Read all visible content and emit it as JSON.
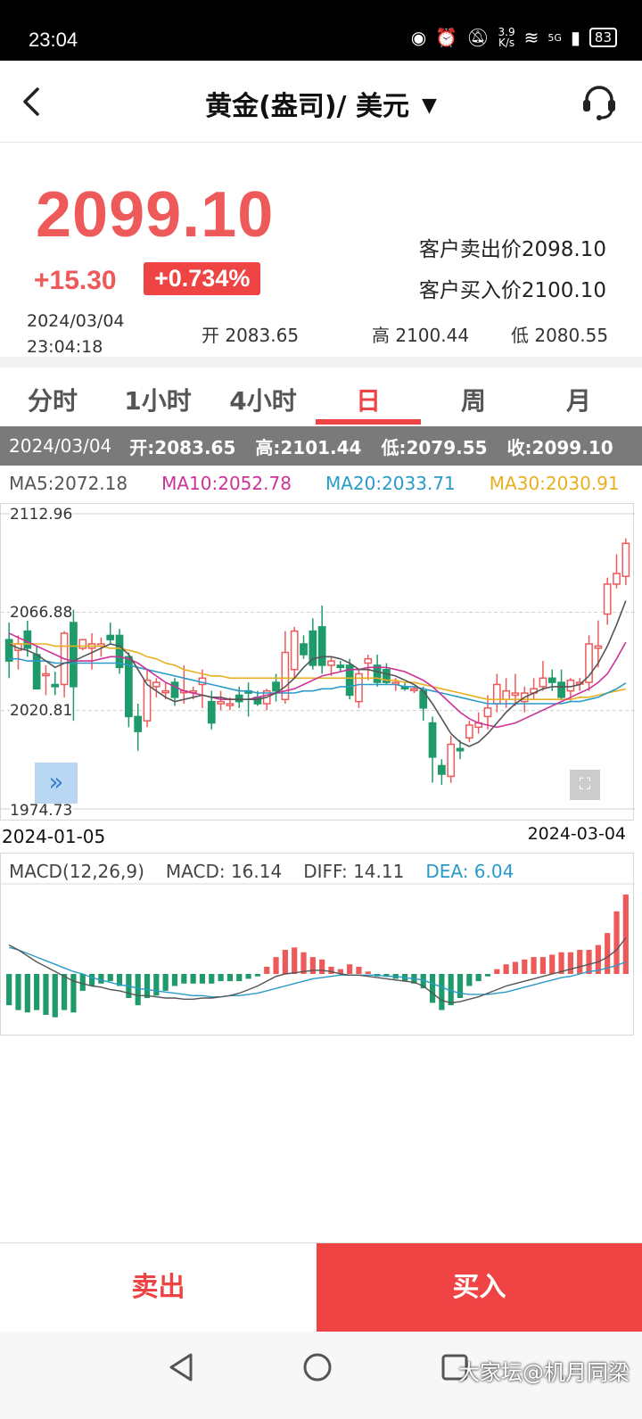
{
  "status": {
    "time": "23:04",
    "net_speed": "3.9",
    "net_unit": "K/s",
    "network": "5G",
    "battery": "83"
  },
  "header": {
    "title": "黄金(盎司)/ 美元",
    "caret": "▼"
  },
  "quote": {
    "price": "2099.10",
    "change": "+15.30",
    "change_pct": "+0.734%",
    "sell_price": "客户卖出价2098.10",
    "buy_price": "客户买入价2100.10",
    "date": "2024/03/04",
    "time": "23:04:18",
    "open": "开 2083.65",
    "high": "高 2100.44",
    "low": "低 2080.55"
  },
  "tabs": [
    {
      "label": "分时",
      "active": false
    },
    {
      "label": "1小时",
      "active": false
    },
    {
      "label": "4小时",
      "active": false
    },
    {
      "label": "日",
      "active": true
    },
    {
      "label": "周",
      "active": false
    },
    {
      "label": "月",
      "active": false
    }
  ],
  "info": {
    "date": "2024/03/04",
    "open": "开:2083.65",
    "high": "高:2101.44",
    "low": "低:2079.55",
    "close": "收:2099.10"
  },
  "ma": {
    "ma5": "MA5:2072.18",
    "ma10": "MA10:2052.78",
    "ma20": "MA20:2033.71",
    "ma30": "MA30:2030.91"
  },
  "colors": {
    "up": "#ee5a5a",
    "down": "#1f9a6a",
    "ma5": "#555555",
    "ma10": "#cc3399",
    "ma20": "#2a9ac8",
    "ma30": "#e8b020"
  },
  "chart": {
    "y_labels": [
      "2112.96",
      "2066.88",
      "2020.81",
      "1974.73"
    ],
    "date_start": "2024-01-05",
    "date_end": "2024-03-04",
    "expand_icon": "»",
    "fullscreen_icon": "⛶"
  },
  "macd": {
    "title": "MACD(12,26,9)",
    "macd": "MACD: 16.14",
    "diff": "DIFF: 14.11",
    "dea": "DEA: 6.04"
  },
  "actions": {
    "sell": "卖出",
    "buy": "买入"
  },
  "watermark": "大家坛@机月同梁",
  "chart_data": {
    "type": "candlestick",
    "ylim": [
      1974.73,
      2112.96
    ],
    "y_ticks": [
      2112.96,
      2066.88,
      2020.81,
      1974.73
    ],
    "x_range": [
      "2024-01-05",
      "2024-03-04"
    ],
    "candles": [
      {
        "o": 2054,
        "h": 2062,
        "l": 2036,
        "c": 2044
      },
      {
        "o": 2049,
        "h": 2056,
        "l": 2040,
        "c": 2052
      },
      {
        "o": 2058,
        "h": 2063,
        "l": 2046,
        "c": 2050
      },
      {
        "o": 2047,
        "h": 2051,
        "l": 2032,
        "c": 2031
      },
      {
        "o": 2038,
        "h": 2042,
        "l": 2028,
        "c": 2038
      },
      {
        "o": 2033,
        "h": 2039,
        "l": 2028,
        "c": 2032
      },
      {
        "o": 2033,
        "h": 2058,
        "l": 2027,
        "c": 2057
      },
      {
        "o": 2062,
        "h": 2068,
        "l": 2016,
        "c": 2032
      },
      {
        "o": 2050,
        "h": 2054,
        "l": 2049,
        "c": 2054
      },
      {
        "o": 2050,
        "h": 2057,
        "l": 2040,
        "c": 2052
      },
      {
        "o": 2051,
        "h": 2055,
        "l": 2046,
        "c": 2052
      },
      {
        "o": 2056,
        "h": 2062,
        "l": 2052,
        "c": 2054
      },
      {
        "o": 2056,
        "h": 2059,
        "l": 2038,
        "c": 2041
      },
      {
        "o": 2046,
        "h": 2048,
        "l": 2013,
        "c": 2018
      },
      {
        "o": 2018,
        "h": 2024,
        "l": 2002,
        "c": 2011
      },
      {
        "o": 2016,
        "h": 2040,
        "l": 2013,
        "c": 2035
      },
      {
        "o": 2032,
        "h": 2036,
        "l": 2027,
        "c": 2034
      },
      {
        "o": 2030,
        "h": 2034,
        "l": 2026,
        "c": 2030
      },
      {
        "o": 2034,
        "h": 2036,
        "l": 2023,
        "c": 2027
      },
      {
        "o": 2030,
        "h": 2042,
        "l": 2024,
        "c": 2030
      },
      {
        "o": 2030,
        "h": 2032,
        "l": 2026,
        "c": 2030
      },
      {
        "o": 2033,
        "h": 2040,
        "l": 2022,
        "c": 2036
      },
      {
        "o": 2025,
        "h": 2030,
        "l": 2012,
        "c": 2015
      },
      {
        "o": 2024,
        "h": 2030,
        "l": 2021,
        "c": 2025
      },
      {
        "o": 2024,
        "h": 2027,
        "l": 2021,
        "c": 2024
      },
      {
        "o": 2028,
        "h": 2032,
        "l": 2022,
        "c": 2025
      },
      {
        "o": 2030,
        "h": 2034,
        "l": 2018,
        "c": 2029
      },
      {
        "o": 2027,
        "h": 2030,
        "l": 2023,
        "c": 2024
      },
      {
        "o": 2024,
        "h": 2031,
        "l": 2021,
        "c": 2030
      },
      {
        "o": 2034,
        "h": 2038,
        "l": 2025,
        "c": 2030
      },
      {
        "o": 2026,
        "h": 2058,
        "l": 2024,
        "c": 2048
      },
      {
        "o": 2040,
        "h": 2060,
        "l": 2036,
        "c": 2058
      },
      {
        "o": 2052,
        "h": 2056,
        "l": 2045,
        "c": 2047
      },
      {
        "o": 2058,
        "h": 2064,
        "l": 2040,
        "c": 2042
      },
      {
        "o": 2060,
        "h": 2070,
        "l": 2038,
        "c": 2042
      },
      {
        "o": 2042,
        "h": 2046,
        "l": 2037,
        "c": 2044
      },
      {
        "o": 2042,
        "h": 2044,
        "l": 2039,
        "c": 2041
      },
      {
        "o": 2042,
        "h": 2045,
        "l": 2026,
        "c": 2028
      },
      {
        "o": 2025,
        "h": 2040,
        "l": 2022,
        "c": 2038
      },
      {
        "o": 2043,
        "h": 2047,
        "l": 2035,
        "c": 2045
      },
      {
        "o": 2042,
        "h": 2047,
        "l": 2032,
        "c": 2034
      },
      {
        "o": 2040,
        "h": 2043,
        "l": 2033,
        "c": 2034
      },
      {
        "o": 2034,
        "h": 2036,
        "l": 2030,
        "c": 2034
      },
      {
        "o": 2032,
        "h": 2034,
        "l": 2030,
        "c": 2031
      },
      {
        "o": 2031,
        "h": 2032,
        "l": 2029,
        "c": 2031
      },
      {
        "o": 2030,
        "h": 2032,
        "l": 2016,
        "c": 2022
      },
      {
        "o": 2015,
        "h": 2018,
        "l": 1987,
        "c": 1999
      },
      {
        "o": 1995,
        "h": 1998,
        "l": 1986,
        "c": 1991
      },
      {
        "o": 1990,
        "h": 2009,
        "l": 1987,
        "c": 2005
      },
      {
        "o": 2003,
        "h": 2007,
        "l": 1998,
        "c": 2002
      },
      {
        "o": 2008,
        "h": 2016,
        "l": 2006,
        "c": 2014
      },
      {
        "o": 2013,
        "h": 2020,
        "l": 2010,
        "c": 2015
      },
      {
        "o": 2018,
        "h": 2028,
        "l": 2012,
        "c": 2022
      },
      {
        "o": 2024,
        "h": 2038,
        "l": 2020,
        "c": 2033
      },
      {
        "o": 2026,
        "h": 2036,
        "l": 2022,
        "c": 2030
      },
      {
        "o": 2028,
        "h": 2038,
        "l": 2023,
        "c": 2029
      },
      {
        "o": 2025,
        "h": 2032,
        "l": 2020,
        "c": 2029
      },
      {
        "o": 2029,
        "h": 2036,
        "l": 2026,
        "c": 2031
      },
      {
        "o": 2032,
        "h": 2044,
        "l": 2030,
        "c": 2036
      },
      {
        "o": 2036,
        "h": 2040,
        "l": 2030,
        "c": 2034
      },
      {
        "o": 2034,
        "h": 2040,
        "l": 2026,
        "c": 2027
      },
      {
        "o": 2030,
        "h": 2036,
        "l": 2025,
        "c": 2035
      },
      {
        "o": 2034,
        "h": 2036,
        "l": 2030,
        "c": 2034
      },
      {
        "o": 2034,
        "h": 2056,
        "l": 2030,
        "c": 2052
      },
      {
        "o": 2050,
        "h": 2063,
        "l": 2041,
        "c": 2051
      },
      {
        "o": 2066,
        "h": 2083,
        "l": 2061,
        "c": 2080
      },
      {
        "o": 2080,
        "h": 2094,
        "l": 2078,
        "c": 2085
      },
      {
        "o": 2083.65,
        "h": 2101.44,
        "l": 2079.55,
        "c": 2099.1
      }
    ],
    "ma5": [
      2052,
      2050,
      2049,
      2047,
      2044,
      2041,
      2043,
      2044,
      2046,
      2048,
      2050,
      2052,
      2051,
      2047,
      2040,
      2033,
      2030,
      2027,
      2025,
      2026,
      2027,
      2028,
      2027,
      2027,
      2026,
      2026,
      2026,
      2026,
      2027,
      2029,
      2032,
      2036,
      2041,
      2045,
      2046,
      2046,
      2045,
      2043,
      2040,
      2040,
      2039,
      2038,
      2037,
      2035,
      2033,
      2030,
      2024,
      2017,
      2010,
      2006,
      2004,
      2006,
      2010,
      2015,
      2020,
      2024,
      2027,
      2029,
      2031,
      2032,
      2032,
      2032,
      2033,
      2037,
      2043,
      2051,
      2061,
      2072.18
    ],
    "ma10": [
      2057,
      2055,
      2053,
      2051,
      2049,
      2047,
      2045,
      2044,
      2044,
      2044,
      2045,
      2046,
      2046,
      2045,
      2043,
      2040,
      2037,
      2034,
      2032,
      2030,
      2029,
      2028,
      2027,
      2026,
      2026,
      2026,
      2026,
      2027,
      2028,
      2029,
      2030,
      2031,
      2033,
      2035,
      2037,
      2038,
      2039,
      2040,
      2040,
      2041,
      2041,
      2041,
      2040,
      2039,
      2037,
      2035,
      2032,
      2028,
      2024,
      2020,
      2017,
      2015,
      2014,
      2013,
      2014,
      2015,
      2017,
      2019,
      2021,
      2023,
      2025,
      2027,
      2029,
      2031,
      2034,
      2038,
      2045,
      2052.78
    ],
    "ma20": [
      2045,
      2045,
      2044,
      2044,
      2044,
      2043,
      2043,
      2043,
      2043,
      2043,
      2043,
      2043,
      2043,
      2042,
      2041,
      2040,
      2039,
      2038,
      2037,
      2036,
      2035,
      2034,
      2033,
      2032,
      2031,
      2030,
      2030,
      2029,
      2029,
      2029,
      2029,
      2029,
      2030,
      2030,
      2031,
      2031,
      2032,
      2032,
      2033,
      2033,
      2033,
      2033,
      2033,
      2032,
      2032,
      2031,
      2030,
      2029,
      2028,
      2027,
      2026,
      2025,
      2024,
      2024,
      2024,
      2024,
      2024,
      2024,
      2024,
      2024,
      2024,
      2025,
      2025,
      2026,
      2027,
      2029,
      2031,
      2033.71
    ],
    "ma30": [
      2052,
      2052,
      2052,
      2052,
      2052,
      2051,
      2051,
      2051,
      2051,
      2051,
      2051,
      2050,
      2050,
      2049,
      2048,
      2046,
      2045,
      2043,
      2042,
      2040,
      2039,
      2038,
      2037,
      2037,
      2036,
      2036,
      2036,
      2036,
      2036,
      2036,
      2036,
      2036,
      2036,
      2036,
      2036,
      2036,
      2036,
      2036,
      2036,
      2036,
      2036,
      2035,
      2035,
      2034,
      2034,
      2033,
      2032,
      2031,
      2030,
      2029,
      2028,
      2027,
      2026,
      2026,
      2026,
      2026,
      2026,
      2026,
      2026,
      2026,
      2026,
      2026,
      2027,
      2027,
      2028,
      2029,
      2030,
      2030.91
    ],
    "macd_hist": [
      -26,
      -30,
      -32,
      -30,
      -34,
      -36,
      -30,
      -32,
      -14,
      -10,
      -8,
      -6,
      -10,
      -20,
      -26,
      -20,
      -18,
      -14,
      -10,
      -8,
      -8,
      -8,
      -8,
      -6,
      -6,
      -6,
      -4,
      -2,
      6,
      14,
      20,
      22,
      18,
      14,
      12,
      6,
      4,
      8,
      6,
      2,
      -2,
      -2,
      -4,
      -6,
      -8,
      -12,
      -24,
      -30,
      -26,
      -20,
      -10,
      -6,
      -2,
      4,
      8,
      10,
      12,
      14,
      14,
      16,
      18,
      18,
      20,
      20,
      24,
      34,
      52,
      66
    ],
    "macd_diff": [
      24,
      20,
      15,
      10,
      6,
      2,
      -2,
      -6,
      -8,
      -10,
      -11,
      -13,
      -14,
      -16,
      -18,
      -18,
      -19,
      -20,
      -20,
      -21,
      -21,
      -20,
      -20,
      -19,
      -18,
      -16,
      -13,
      -10,
      -6,
      -2,
      0,
      1,
      2,
      3,
      3,
      2,
      0,
      -1,
      -1,
      -2,
      -3,
      -4,
      -5,
      -6,
      -7,
      -10,
      -16,
      -22,
      -24,
      -23,
      -21,
      -19,
      -16,
      -13,
      -10,
      -8,
      -6,
      -4,
      -2,
      0,
      2,
      4,
      6,
      8,
      10,
      14,
      20,
      30
    ],
    "macd_dea": [
      22,
      20,
      17,
      14,
      11,
      8,
      5,
      2,
      0,
      -3,
      -5,
      -7,
      -9,
      -10,
      -12,
      -13,
      -14,
      -15,
      -16,
      -17,
      -18,
      -18,
      -19,
      -19,
      -18,
      -18,
      -17,
      -16,
      -14,
      -12,
      -10,
      -8,
      -6,
      -4,
      -3,
      -2,
      -1,
      -1,
      -1,
      -1,
      -1,
      -2,
      -2,
      -3,
      -4,
      -5,
      -8,
      -11,
      -14,
      -16,
      -17,
      -17,
      -17,
      -16,
      -15,
      -13,
      -11,
      -9,
      -7,
      -5,
      -3,
      -2,
      0,
      2,
      3,
      5,
      7,
      10
    ]
  }
}
